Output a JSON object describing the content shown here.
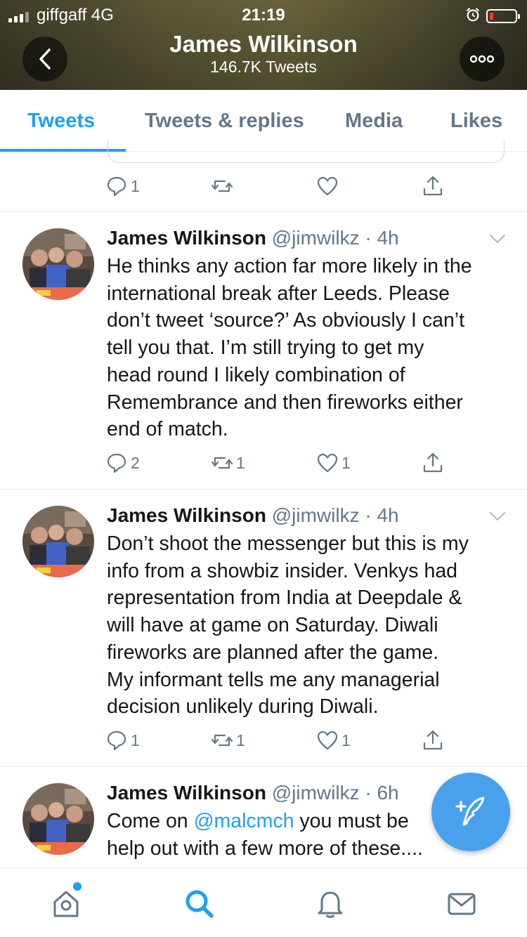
{
  "status_bar": {
    "carrier": "giffgaff 4G",
    "time": "21:19"
  },
  "header": {
    "title": "James Wilkinson",
    "subtitle": "146.7K Tweets"
  },
  "tabs": [
    {
      "label": "Tweets",
      "active": true
    },
    {
      "label": "Tweets & replies",
      "active": false
    },
    {
      "label": "Media",
      "active": false
    },
    {
      "label": "Likes",
      "active": false
    }
  ],
  "partial_tweet": {
    "reply_count": "1",
    "retweet_count": "",
    "like_count": ""
  },
  "tweets": [
    {
      "name": "James Wilkinson",
      "handle": "@jimwilkz",
      "separator": "·",
      "time": "4h",
      "text_lines": [
        "He thinks any action far more likely in the",
        "international break after Leeds. Please",
        "don’t tweet ‘source?’ As obviously I can’t",
        "tell you that. I’m still trying to get my",
        "head round I likely combination of",
        "Remembrance and then fireworks either",
        "end of match."
      ],
      "reply_count": "2",
      "retweet_count": "1",
      "like_count": "1"
    },
    {
      "name": "James Wilkinson",
      "handle": "@jimwilkz",
      "separator": "·",
      "time": "4h",
      "text_lines": [
        "Don’t shoot the messenger but this is my",
        "info from a showbiz insider. Venkys had",
        "representation from India at Deepdale &",
        "will have at game on Saturday. Diwali",
        "fireworks are planned after the game.",
        "My informant tells me any managerial",
        "decision unlikely during Diwali."
      ],
      "reply_count": "1",
      "retweet_count": "1",
      "like_count": "1"
    },
    {
      "name": "James Wilkinson",
      "handle": "@jimwilkz",
      "separator": "·",
      "time": "6h",
      "line1_pre": "Come on ",
      "line1_mention": "@malcmch",
      "line1_post": " you must be",
      "line2": "help out with a few more of these...."
    }
  ],
  "colors": {
    "accent": "#1da1f2",
    "muted": "#657786",
    "text": "#14171a",
    "fab": "#4aa1eb"
  },
  "icons": {
    "reply": "reply-icon",
    "retweet": "retweet-icon",
    "like": "heart-icon",
    "share": "share-icon",
    "home": "home-icon",
    "search": "search-icon",
    "notifications": "bell-icon",
    "messages": "mail-icon",
    "compose": "compose-tweet-icon"
  }
}
